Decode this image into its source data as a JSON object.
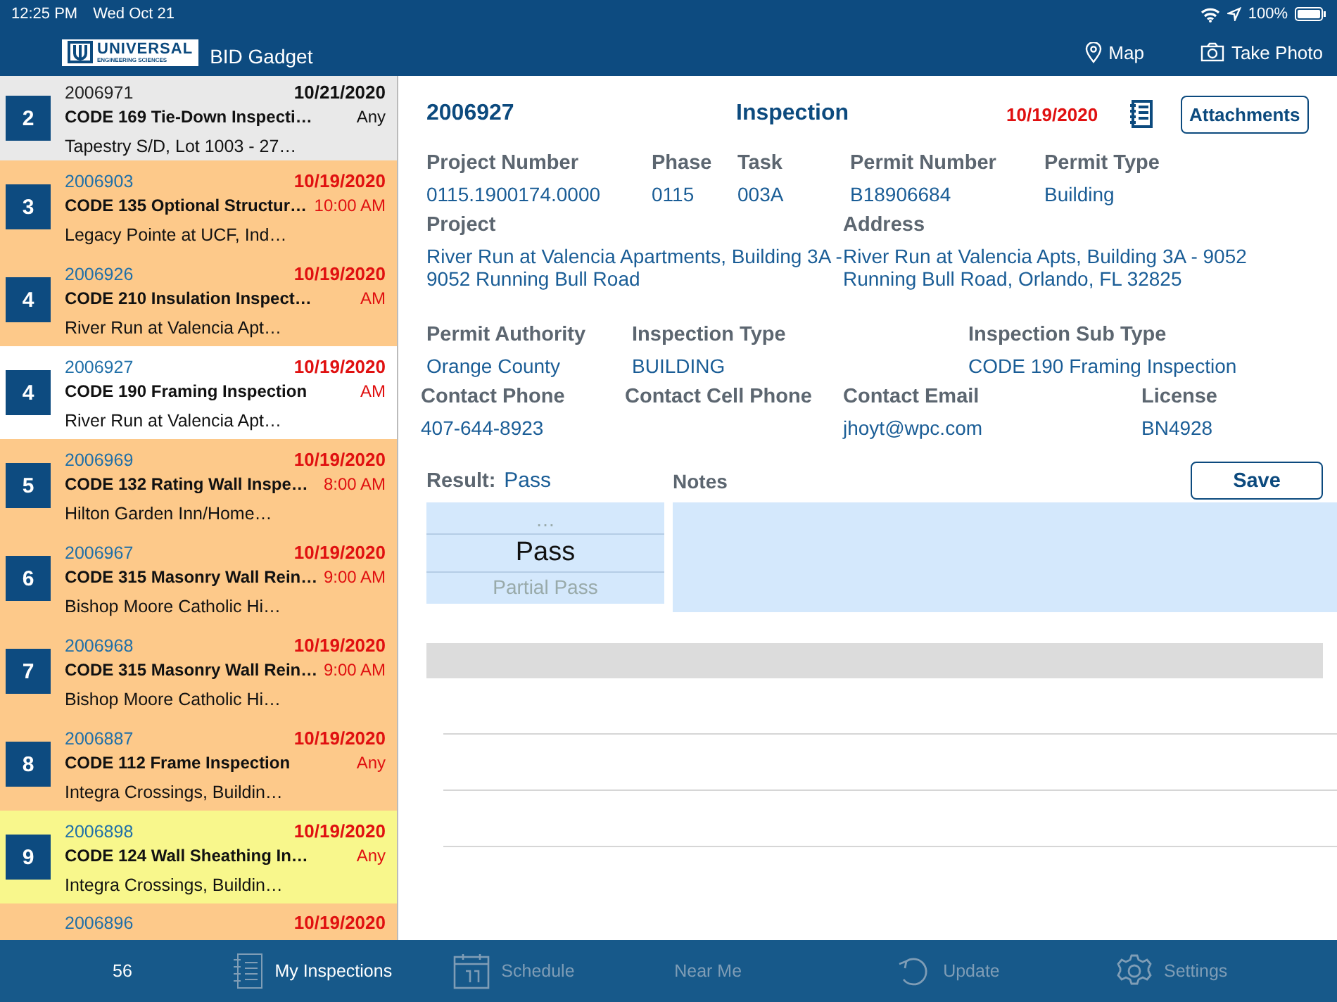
{
  "status_bar": {
    "time": "12:25 PM",
    "date": "Wed Oct 21",
    "battery": "100%"
  },
  "nav_bar": {
    "logo_name": "UNIVERSAL",
    "logo_subtitle": "ENGINEERING SCIENCES",
    "app_title": "BID Gadget",
    "actions": [
      "Map",
      "Take Photo"
    ]
  },
  "sidebar": {
    "items": [
      {
        "number": "2",
        "id": "2006971",
        "date": "10/21/2020",
        "title": "CODE 169 Tie-Down Inspecti…",
        "time": "Any",
        "place": "Tapestry S/D, Lot 1003 - 27…",
        "overdue": false,
        "selected": false,
        "color": "#e9e9e9"
      },
      {
        "number": "3",
        "id": "2006903",
        "date": "10/19/2020",
        "title": "CODE 135 Optional Structur…",
        "time": "10:00 AM",
        "place": "Legacy Pointe at UCF, Ind…",
        "overdue": true,
        "selected": false,
        "color": "#fdc98a"
      },
      {
        "number": "4",
        "id": "2006926",
        "date": "10/19/2020",
        "title": "CODE 210 Insulation Inspect…",
        "time": "AM",
        "place": "River Run at Valencia Apt…",
        "overdue": true,
        "selected": false,
        "color": "#fdc98a"
      },
      {
        "number": "4",
        "id": "2006927",
        "date": "10/19/2020",
        "title": "CODE 190 Framing Inspection",
        "time": "AM",
        "place": "River Run at Valencia Apt…",
        "overdue": true,
        "selected": true
      },
      {
        "number": "5",
        "id": "2006969",
        "date": "10/19/2020",
        "title": "CODE 132 Rating Wall Inspe…",
        "time": "8:00 AM",
        "place": "Hilton Garden Inn/Home…",
        "overdue": true,
        "selected": false,
        "color": "#fdc98a"
      },
      {
        "number": "6",
        "id": "2006967",
        "date": "10/19/2020",
        "title": "CODE 315 Masonry Wall Rein…",
        "time": "9:00 AM",
        "place": "Bishop Moore Catholic Hi…",
        "overdue": true,
        "selected": false,
        "color": "#fdc98a"
      },
      {
        "number": "7",
        "id": "2006968",
        "date": "10/19/2020",
        "title": "CODE 315 Masonry Wall Rein…",
        "time": "9:00 AM",
        "place": "Bishop Moore Catholic Hi…",
        "overdue": true,
        "selected": false,
        "color": "#fdc98a"
      },
      {
        "number": "8",
        "id": "2006887",
        "date": "10/19/2020",
        "title": "CODE 112 Frame Inspection",
        "time": "Any",
        "place": "Integra Crossings, Buildin…",
        "overdue": true,
        "selected": false,
        "color": "#fdc98a"
      },
      {
        "number": "9",
        "id": "2006898",
        "date": "10/19/2020",
        "title": "CODE 124 Wall Sheathing In…",
        "time": "Any",
        "place": "Integra Crossings, Buildin…",
        "overdue": true,
        "selected": false,
        "color": "#f8f78c"
      },
      {
        "id": "2006896",
        "date": "10/19/2020",
        "overdue": true,
        "selected": false,
        "color": "#fdc98a"
      }
    ]
  },
  "detail": {
    "id": "2006927",
    "heading": "Inspection",
    "date": "10/19/2020",
    "attachments_button": "Attachments",
    "field_rows": [
      [
        {
          "label": "Project Number",
          "value": "0115.1900174.0000"
        },
        {
          "label": "Phase",
          "value": "0115"
        },
        {
          "label": "Task",
          "value": "003A"
        },
        {
          "label": "Permit Number",
          "value": "B18906684"
        },
        {
          "label": "Permit Type",
          "value": "Building"
        }
      ],
      [
        {
          "label": "Project",
          "value": "River Run at Valencia Apartments, Building 3A - 9052 Running Bull Road"
        },
        {
          "label": "Address",
          "value": "River Run at Valencia Apts, Building 3A - 9052 Running Bull Road,  Orlando,  FL 32825"
        }
      ],
      [
        {
          "label": "Permit Authority",
          "value": "Orange County"
        },
        {
          "label": "Inspection Type",
          "value": "BUILDING"
        },
        {
          "label": "Inspection Sub Type",
          "value": "CODE 190 Framing Inspection"
        }
      ],
      [
        {
          "label": "Contact Phone",
          "value": "407-644-8923"
        },
        {
          "label": "Contact Cell Phone"
        },
        {
          "label": "Contact Email",
          "value": "jhoyt@wpc.com"
        },
        {
          "label": "License",
          "value": "BN4928"
        }
      ]
    ],
    "result_label": "Result:",
    "result_value": "Pass",
    "result_options": [
      {
        "label": "…",
        "selected": false
      },
      {
        "label": "Pass",
        "selected": true
      },
      {
        "label": "Partial Pass",
        "selected": false
      }
    ],
    "notes_label": "Notes",
    "save_button": "Save"
  },
  "tab_bar": {
    "count": "56",
    "tabs": [
      {
        "label": "My Inspections",
        "selected": true
      },
      {
        "label": "Schedule",
        "selected": false
      },
      {
        "label": "Near Me",
        "selected": false
      },
      {
        "label": "Update",
        "selected": false
      },
      {
        "label": "Settings",
        "selected": false
      }
    ]
  }
}
